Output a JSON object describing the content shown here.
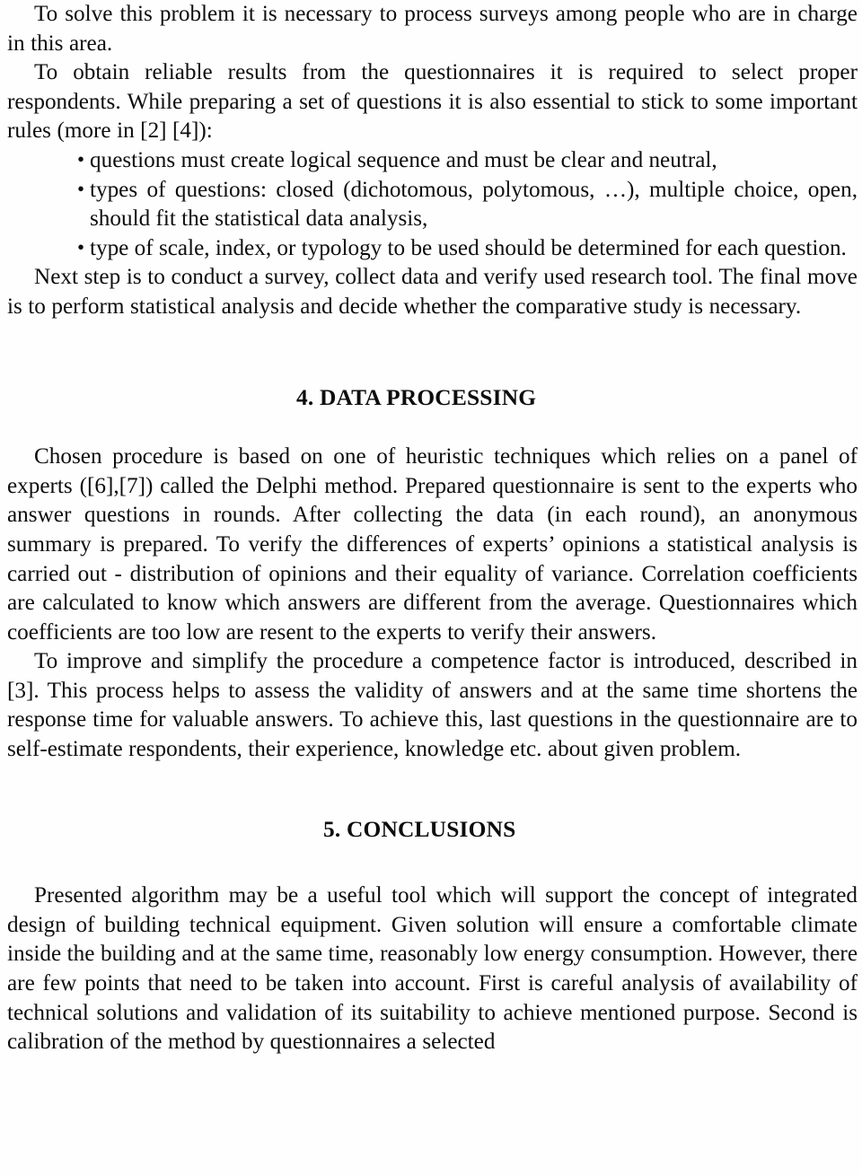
{
  "document": {
    "type": "scanned-academic-paper-page",
    "text_color": "#0d0d0d",
    "background_color": "#fefefe"
  },
  "body": {
    "paragraph_1": "To solve this problem it is necessary to process surveys among people who are in charge in this area.",
    "paragraph_2_intro": "To obtain reliable results from the questionnaires it is required to select proper respondents. While preparing a set of questions it is also essential to stick to some important rules (more in [2] [4]):",
    "bullets": [
      {
        "marker": "•",
        "text": "questions must create logical sequence and must be clear and neutral,"
      },
      {
        "marker": "•",
        "text": "types of questions: closed (dichotomous, polytomous, …), multiple choice, open, should fit the statistical data analysis,"
      },
      {
        "marker": "•",
        "text": "type of scale, index, or typology to be used should be determined for each question."
      }
    ],
    "paragraph_3": "Next step is to conduct a survey, collect data and verify used research tool. The final move is to perform statistical analysis and decide whether the comparative study is necessary."
  },
  "section_4": {
    "heading": "4. DATA PROCESSING",
    "paragraph_1": "Chosen procedure is based on one of heuristic techniques which relies on a panel of experts ([6],[7]) called the Delphi method. Prepared questionnaire is sent to the experts who answer questions in rounds. After collecting the data (in each round), an anonymous summary is prepared. To verify the differences of experts’ opinions a statistical analysis is carried out - distribution of opinions and their equality of variance. Correlation coefficients are calculated to know which answers are different from the average. Questionnaires which coefficients are too low are resent to the experts to verify their answers.",
    "paragraph_2": "To improve and simplify the procedure a competence factor is introduced, described in [3]. This process helps to assess the validity of answers and at the same time shortens the response time for valuable answers. To achieve this, last questions in the questionnaire are to self-estimate respondents, their experience, knowledge etc. about given problem."
  },
  "section_5": {
    "heading": "5. CONCLUSIONS",
    "paragraph_1": "Presented algorithm may be a useful tool which will support the concept of integrated design of building technical equipment. Given solution will ensure a comfortable climate inside the building and at the same time, reasonably low energy consumption. However, there are few points that need to be taken into account. First is careful analysis of availability of technical solutions and validation of its suitability to achieve mentioned purpose. Second is calibration of the method by questionnaires a selected"
  }
}
